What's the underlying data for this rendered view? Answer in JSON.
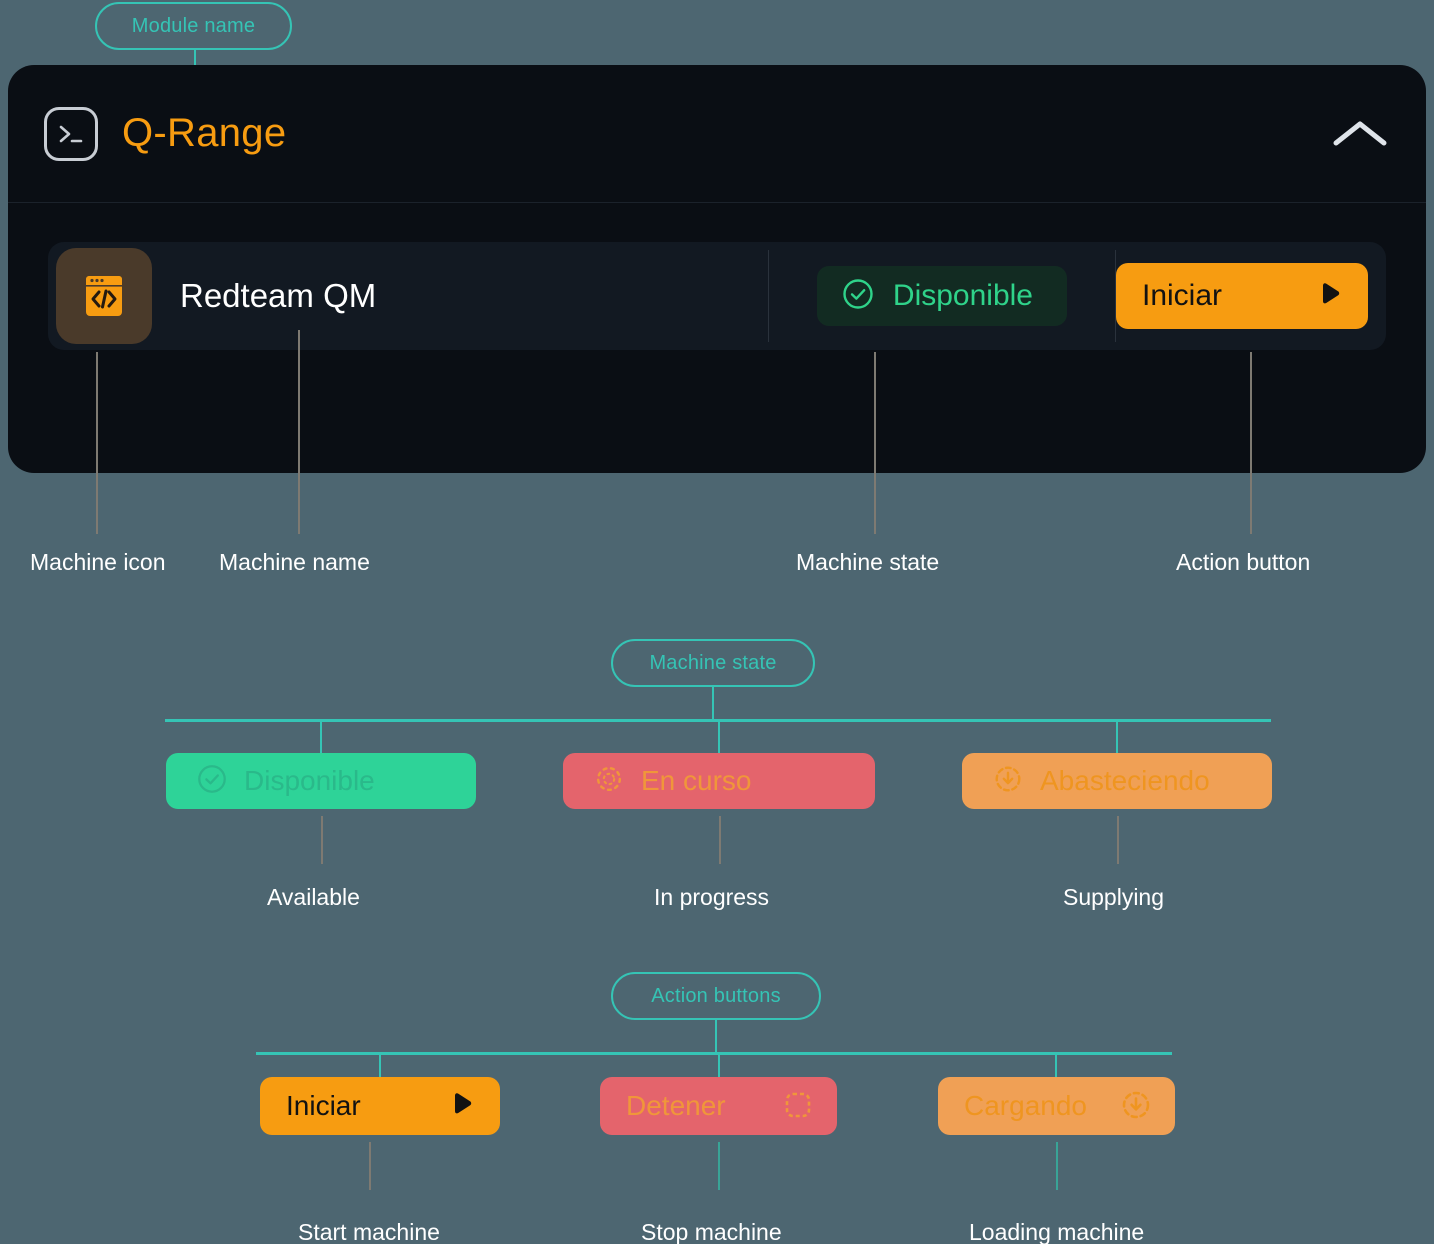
{
  "annotations": {
    "module_name": "Module name",
    "machine_state_group": "Machine state",
    "action_buttons_group": "Action buttons",
    "machine_icon": "Machine icon",
    "machine_name": "Machine name",
    "machine_state": "Machine state",
    "action_button": "Action button"
  },
  "card": {
    "module_title": "Q-Range",
    "terminal_icon": "terminal-icon",
    "collapse_icon": "chevron-up-icon",
    "machine": {
      "icon": "code-window-icon",
      "name": "Redteam QM",
      "state": {
        "label": "Disponible",
        "icon": "check-circle-icon",
        "bg": "#122b22",
        "fg": "#2fd38a"
      },
      "action": {
        "label": "Iniciar",
        "icon": "play-icon",
        "bg": "#f79c11",
        "fg": "#121212"
      }
    }
  },
  "states_legend": {
    "title": "Machine state",
    "items": [
      {
        "label": "Disponible",
        "translation": "Available",
        "icon": "check-circle-icon",
        "bg": "#2ed398",
        "fg": "#2ab98a"
      },
      {
        "label": "En curso",
        "translation": "In progress",
        "icon": "spinner-dotted-icon",
        "bg": "#e4646c",
        "fg": "#f0963a"
      },
      {
        "label": "Abasteciendo",
        "translation": "Supplying",
        "icon": "download-circle-icon",
        "bg": "#f0a055",
        "fg": "#ef9520"
      }
    ]
  },
  "actions_legend": {
    "title": "Action buttons",
    "items": [
      {
        "label": "Iniciar",
        "translation": "Start machine",
        "icon": "play-icon",
        "bg": "#f79c11",
        "fg": "#121212"
      },
      {
        "label": "Detener",
        "translation": "Stop machine",
        "icon": "stop-square-icon",
        "bg": "#e4646c",
        "fg": "#f0963a"
      },
      {
        "label": "Cargando",
        "translation": "Loading machine",
        "icon": "download-circle-icon",
        "bg": "#f0a055",
        "fg": "#ef9520"
      }
    ]
  },
  "colors": {
    "page_bg": "#4d6671",
    "card_bg": "#0a0e14",
    "row_bg": "#121922",
    "accent_orange": "#f79c11",
    "accent_teal": "#35c4b5",
    "accent_green": "#2ed398",
    "accent_red": "#e4646c"
  }
}
